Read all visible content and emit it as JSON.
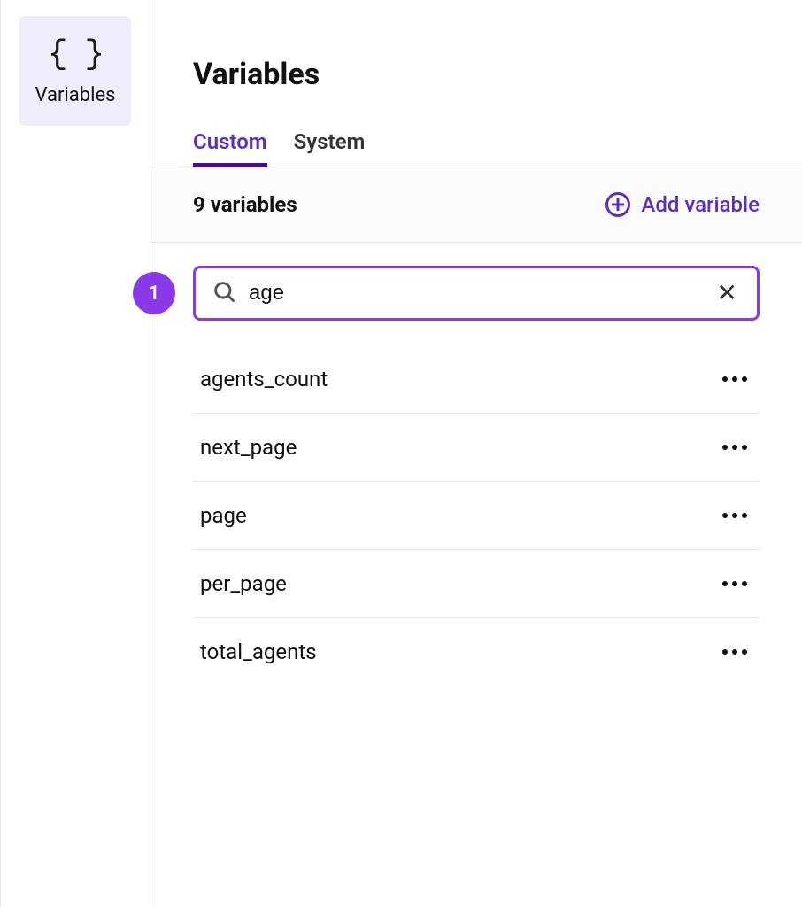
{
  "sidebar": {
    "tile": {
      "label": "Variables"
    }
  },
  "header": {
    "title": "Variables"
  },
  "tabs": {
    "custom": "Custom",
    "system": "System"
  },
  "bar": {
    "count_text": "9 variables",
    "add_label": "Add variable"
  },
  "badge": {
    "step": "1"
  },
  "search": {
    "value": "age",
    "placeholder": ""
  },
  "variables": [
    "agents_count",
    "next_page",
    "page",
    "per_page",
    "total_agents"
  ]
}
